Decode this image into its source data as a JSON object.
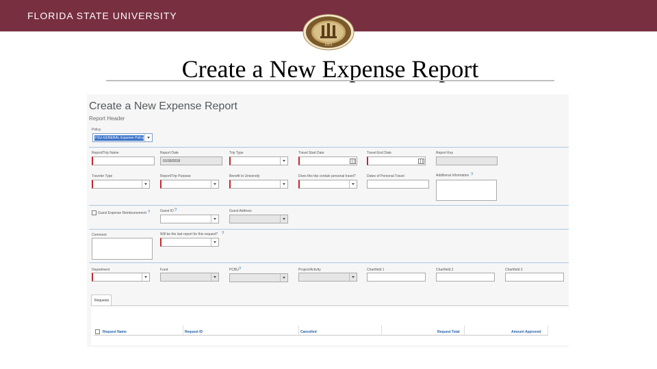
{
  "header": {
    "university": "FLORIDA STATE UNIVERSITY",
    "seal_year": "1851",
    "seal_text": "FLORIDA STATE UNIVERSITY"
  },
  "slide": {
    "title": "Create a New Expense Report"
  },
  "form": {
    "title": "Create a New Expense Report",
    "subtitle": "Report Header",
    "policy": {
      "label": "Policy",
      "value": "FSU-GENERAL-Expense Policy"
    },
    "row1": {
      "report_name": "Report/Trip Name",
      "report_date": "Report Date",
      "report_date_value": "01/30/2018",
      "trip_type": "Trip Type",
      "travel_start": "Travel Start Date",
      "travel_end": "Travel End Date",
      "report_key": "Report Key"
    },
    "row2": {
      "traveler_type": "Traveler Type",
      "purpose": "Report/Trip Purpose",
      "benefit": "Benefit to University",
      "personal_travel": "Does this trip contain personal travel?",
      "personal_dates": "Dates of Personal Travel",
      "additional_info": "Additional Information"
    },
    "row3": {
      "guest_reimb": "Guest Expense Reimbursement",
      "guest_id": "Guest ID",
      "guest_address": "Guest Address"
    },
    "row4": {
      "comment": "Comment",
      "last_report": "Will be the last report for this request?"
    },
    "row5": {
      "department": "Department",
      "fund": "Fund",
      "pcbu": "PCBU",
      "project": "Project/Activity",
      "cf1": "Chartfield 1",
      "cf2": "Chartfield 2",
      "cf3": "Chartfield 3"
    },
    "requests": {
      "tab": "Requests",
      "columns": [
        "Request Name",
        "Request ID",
        "Cancelled",
        "Request Total",
        "Amount Approved"
      ]
    }
  },
  "help_glyph": "?",
  "colors": {
    "brand_garnet": "#782f40",
    "required_marker": "#c1272d",
    "link_blue": "#1f5fa6"
  }
}
